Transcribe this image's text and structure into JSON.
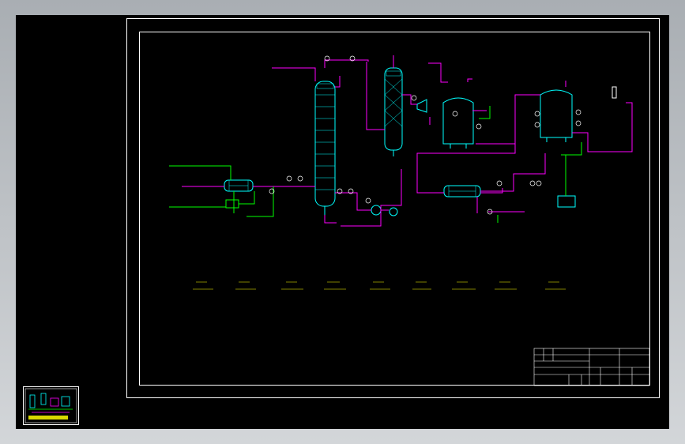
{
  "title_block": {
    "drawing_title": "",
    "company": "",
    "scale": "",
    "sheet": ""
  },
  "equipment_tags": [
    "",
    "",
    "",
    "",
    "",
    "",
    "",
    "",
    ""
  ],
  "colors": {
    "background": "#000000",
    "frame": "#ffffff",
    "equipment": "#00ffff",
    "process_line": "#ff00ff",
    "utility_line": "#00ff00",
    "instrument": "#ffffff"
  }
}
